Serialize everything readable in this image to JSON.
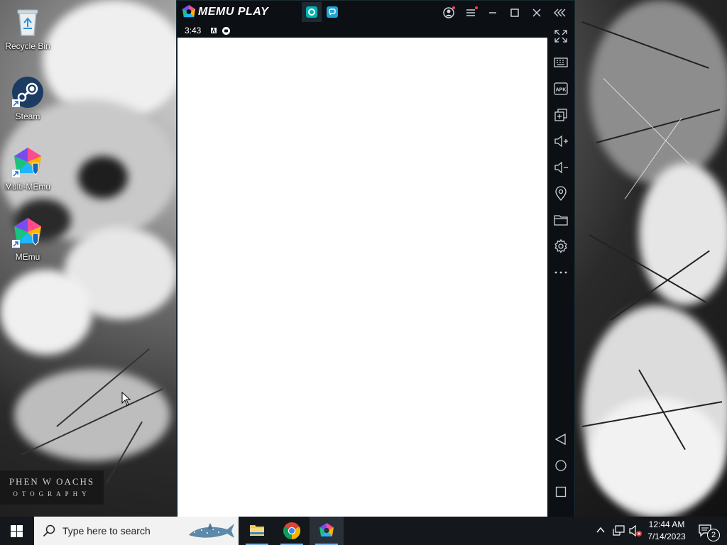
{
  "desktop": {
    "icons": [
      {
        "label": "Recycle Bin",
        "icon": "recycle-bin-icon"
      },
      {
        "label": "Steam",
        "icon": "steam-icon"
      },
      {
        "label": "Multi-MEmu",
        "icon": "multi-memu-icon"
      },
      {
        "label": "MEmu",
        "icon": "memu-icon"
      }
    ],
    "watermark": {
      "line1": "PHEN W OACHS",
      "line2": "OTOGRAPHY"
    }
  },
  "memu": {
    "title": "MEMU PLAY",
    "status_time": "3:43",
    "tabs": [
      {
        "name": "android-home-tab",
        "icon": "android-home-icon",
        "active": true
      },
      {
        "name": "multi-instance-tab",
        "icon": "multi-instance-icon",
        "active": false
      }
    ],
    "titlebar_buttons": [
      "account-icon",
      "menu-icon",
      "minimize-icon",
      "maximize-icon",
      "close-icon",
      "collapse-sidebar-icon"
    ],
    "sidebar": [
      "fullscreen-icon",
      "keyboard-mapping-icon",
      "apk-install-icon",
      "multi-window-icon",
      "volume-up-icon",
      "volume-down-icon",
      "location-icon",
      "folder-icon",
      "settings-icon",
      "more-icon",
      "back-icon",
      "home-icon",
      "recent-apps-icon"
    ],
    "accent": "#00b3b3"
  },
  "taskbar": {
    "search_placeholder": "Type here to search",
    "apps": [
      {
        "name": "file-explorer",
        "icon": "folder-icon"
      },
      {
        "name": "chrome",
        "icon": "chrome-icon"
      },
      {
        "name": "memu",
        "icon": "memu-icon"
      }
    ],
    "time": "12:44 AM",
    "date": "7/14/2023",
    "notification_count": "2"
  }
}
